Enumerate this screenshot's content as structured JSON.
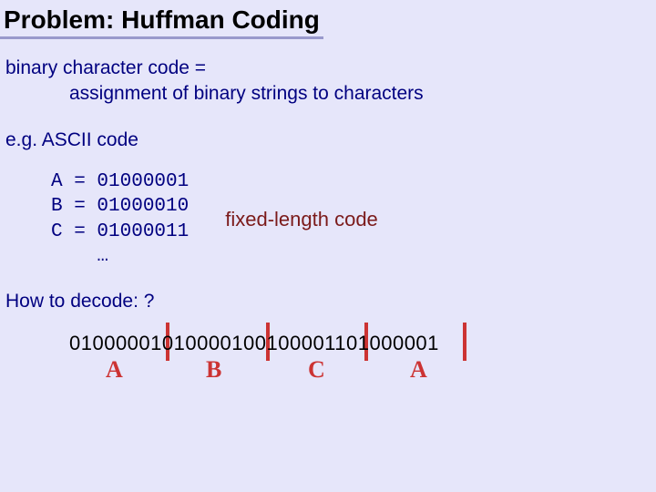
{
  "title": "Problem: Huffman Coding",
  "definition": {
    "line1": "binary character code =",
    "line2": "assignment of binary strings to characters"
  },
  "example_label": "e.g. ASCII code",
  "codes": {
    "a": "A = 01000001",
    "b": "B = 01000010",
    "c": "C = 01000011",
    "dots": "    …"
  },
  "fixed_label": "fixed-length code",
  "decode_label": "How to decode:    ?",
  "bitstring": "01000001010000100100001101000001",
  "annotations": {
    "a1": "A",
    "b": "B",
    "c": "C",
    "a2": "A"
  }
}
